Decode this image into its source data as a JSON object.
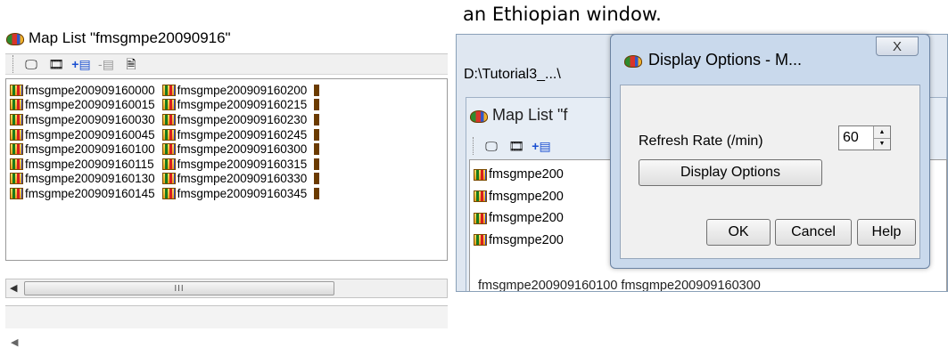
{
  "caption": "an Ethiopian window.",
  "left_window": {
    "title": "Map List \"fmsgmpe20090916\"",
    "toolbar_icons": [
      "display-icon",
      "film-icon",
      "add-layer-icon",
      "remove-layer-icon",
      "properties-icon"
    ],
    "columns": [
      [
        "fmsgmpe200909160000",
        "fmsgmpe200909160015",
        "fmsgmpe200909160030",
        "fmsgmpe200909160045",
        "fmsgmpe200909160100",
        "fmsgmpe200909160115",
        "fmsgmpe200909160130",
        "fmsgmpe200909160145"
      ],
      [
        "fmsgmpe200909160200",
        "fmsgmpe200909160215",
        "fmsgmpe200909160230",
        "fmsgmpe200909160245",
        "fmsgmpe200909160300",
        "fmsgmpe200909160315",
        "fmsgmpe200909160330",
        "fmsgmpe200909160345"
      ]
    ],
    "hscroll_thumb": "III"
  },
  "background_window": {
    "path": "D:\\Tutorial3_...\\",
    "inner_title": "Map List \"f",
    "list_items": [
      "fmsgmpe200",
      "fmsgmpe200",
      "fmsgmpe200",
      "fmsgmpe200"
    ],
    "bottom_text": "fmsgmpe200909160100   fmsgmpe200909160300"
  },
  "dialog": {
    "title": "Display Options - M...",
    "close_glyph": "X",
    "refresh_label": "Refresh Rate (/min)",
    "refresh_value": "60",
    "display_options_button": "Display Options",
    "ok_button": "OK",
    "cancel_button": "Cancel",
    "help_button": "Help"
  }
}
